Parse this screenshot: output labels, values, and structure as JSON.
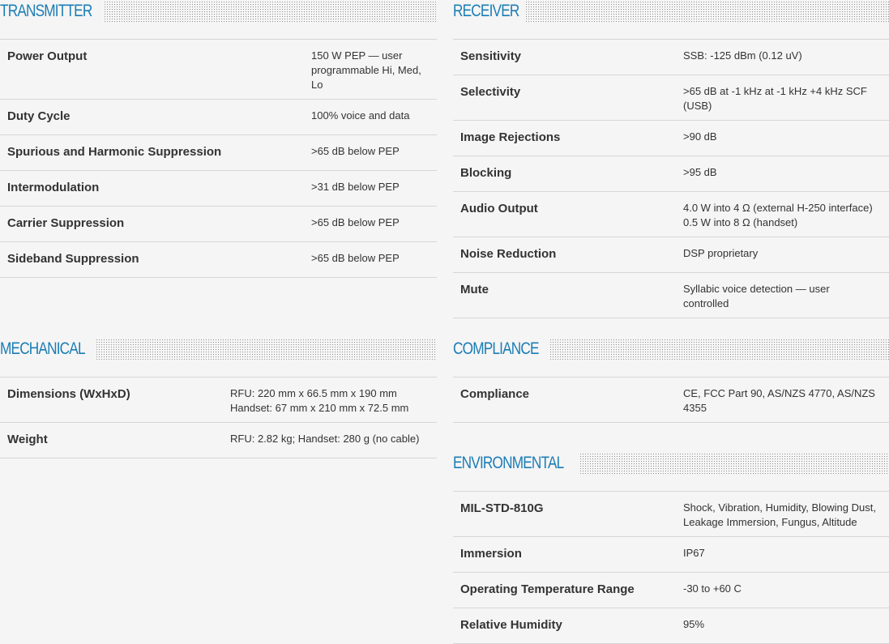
{
  "transmitter": {
    "title": "TRANSMITTER",
    "rows": [
      {
        "label": "Power Output",
        "value": "150 W PEP — user programmable Hi, Med, Lo"
      },
      {
        "label": "Duty Cycle",
        "value": "100% voice and data"
      },
      {
        "label": "Spurious and Harmonic Suppression",
        "value": ">65 dB below PEP"
      },
      {
        "label": "Intermodulation",
        "value": ">31 dB below PEP"
      },
      {
        "label": "Carrier Suppression",
        "value": ">65 dB below PEP"
      },
      {
        "label": "Sideband Suppression",
        "value": ">65 dB below PEP"
      }
    ]
  },
  "receiver": {
    "title": "RECEIVER",
    "rows": [
      {
        "label": "Sensitivity",
        "value": "SSB: -125 dBm (0.12 uV)"
      },
      {
        "label": "Selectivity",
        "value": ">65 dB at -1 kHz at -1 kHz +4 kHz SCF (USB)"
      },
      {
        "label": "Image Rejections",
        "value": ">90 dB"
      },
      {
        "label": "Blocking",
        "value": ">95 dB"
      },
      {
        "label": "Audio Output",
        "value_lines": [
          "4.0 W into 4 Ω (external H-250 interface)",
          "0.5 W into 8 Ω (handset)"
        ]
      },
      {
        "label": "Noise Reduction",
        "value": "DSP proprietary"
      },
      {
        "label": "Mute",
        "value": "Syllabic voice detection — user controlled"
      }
    ]
  },
  "mechanical": {
    "title": "MECHANICAL",
    "rows": [
      {
        "label": "Dimensions (WxHxD)",
        "value_lines": [
          "RFU: 220 mm x 66.5 mm x 190 mm",
          "Handset: 67 mm x 210 mm x 72.5 mm"
        ]
      },
      {
        "label": "Weight",
        "value": "RFU: 2.82 kg; Handset: 280 g (no cable)"
      }
    ]
  },
  "compliance": {
    "title": "COMPLIANCE",
    "rows": [
      {
        "label": "Compliance",
        "value": "CE, FCC Part 90, AS/NZS 4770, AS/NZS 4355"
      }
    ]
  },
  "environmental": {
    "title": "ENVIRONMENTAL",
    "rows": [
      {
        "label": "MIL-STD-810G",
        "value": "Shock, Vibration, Humidity, Blowing Dust, Leakage Immersion, Fungus, Altitude"
      },
      {
        "label": "Immersion",
        "value": "IP67"
      },
      {
        "label": "Operating Temperature Range",
        "value": "-30 to +60 C"
      },
      {
        "label": "Relative Humidity",
        "value": "95%"
      }
    ]
  }
}
